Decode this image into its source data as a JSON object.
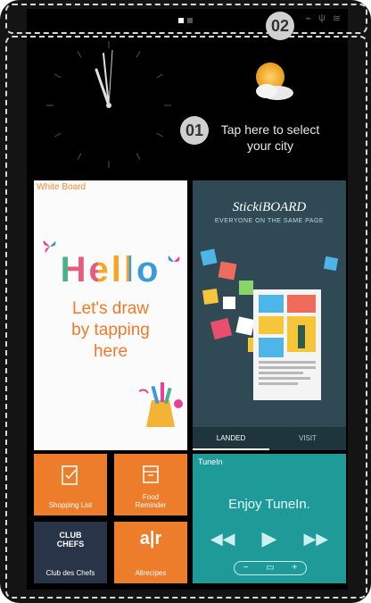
{
  "callouts": {
    "one": "01",
    "two": "02"
  },
  "weather": {
    "line1": "Tap here to select",
    "line2": "your city"
  },
  "tiles": {
    "whiteboard": {
      "title": "White Board",
      "hello": "Hello",
      "line1": "Let's draw",
      "line2": "by tapping",
      "line3": "here"
    },
    "stickiboard": {
      "logo": "StickiBOARD",
      "tagline": "EVERYONE ON THE SAME PAGE",
      "tab_left": "LANDED",
      "tab_right": "VISIT"
    },
    "shopping": {
      "label": "Shopping List"
    },
    "food": {
      "label_line1": "Food",
      "label_line2": "Reminder"
    },
    "chefs": {
      "logo_line1": "CLUB",
      "logo_line2": "CHEFS",
      "label": "Club des Chefs"
    },
    "allrecipes": {
      "logo": "a|r",
      "label": "Allrecipes"
    },
    "tunein": {
      "title": "TuneIn",
      "message": "Enjoy TuneIn."
    }
  },
  "colors": {
    "orange_tile": "#ee7d2b",
    "navy_tile": "#283447",
    "tunein": "#1e9b99",
    "stickiboard": "#2f4a54"
  }
}
